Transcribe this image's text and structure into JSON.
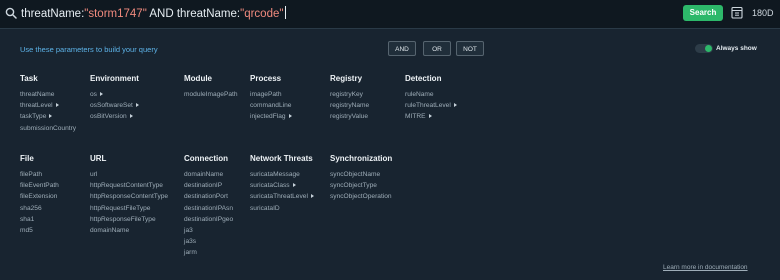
{
  "search": {
    "query": [
      {
        "type": "key",
        "text": "threatName:"
      },
      {
        "type": "val",
        "text": "\"storm1747\""
      },
      {
        "type": "op",
        "text": " AND "
      },
      {
        "type": "key",
        "text": "threatName:"
      },
      {
        "type": "val",
        "text": "\"qrcode\""
      }
    ],
    "search_label": "Search",
    "counter": "180D"
  },
  "panel": {
    "hint": "Use these parameters to build your query",
    "operators": [
      "AND",
      "OR",
      "NOT"
    ],
    "always_show_label": "Always show",
    "always_show_on": true,
    "learn_more": "Learn more in documentation"
  },
  "groups": [
    {
      "title": "Task",
      "items": [
        {
          "label": "threatName",
          "arrow": false
        },
        {
          "label": "threatLevel",
          "arrow": true
        },
        {
          "label": "taskType",
          "arrow": true
        },
        {
          "label": "submissionCountry",
          "arrow": false
        }
      ]
    },
    {
      "title": "Environment",
      "items": [
        {
          "label": "os",
          "arrow": true
        },
        {
          "label": "osSoftwareSet",
          "arrow": true
        },
        {
          "label": "osBitVersion",
          "arrow": true
        }
      ]
    },
    {
      "title": "Module",
      "items": [
        {
          "label": "moduleImagePath",
          "arrow": false
        }
      ]
    },
    {
      "title": "Process",
      "items": [
        {
          "label": "imagePath",
          "arrow": false
        },
        {
          "label": "commandLine",
          "arrow": false
        },
        {
          "label": "injectedFlag",
          "arrow": true
        }
      ]
    },
    {
      "title": "Registry",
      "items": [
        {
          "label": "registryKey",
          "arrow": false
        },
        {
          "label": "registryName",
          "arrow": false
        },
        {
          "label": "registryValue",
          "arrow": false
        }
      ]
    },
    {
      "title": "Detection",
      "items": [
        {
          "label": "ruleName",
          "arrow": false
        },
        {
          "label": "ruleThreatLevel",
          "arrow": true
        },
        {
          "label": "MITRE",
          "arrow": true
        }
      ]
    },
    {
      "title": "File",
      "items": [
        {
          "label": "filePath",
          "arrow": false
        },
        {
          "label": "fileEventPath",
          "arrow": false
        },
        {
          "label": "fileExtension",
          "arrow": false
        },
        {
          "label": "sha256",
          "arrow": false
        },
        {
          "label": "sha1",
          "arrow": false
        },
        {
          "label": "md5",
          "arrow": false
        }
      ]
    },
    {
      "title": "URL",
      "items": [
        {
          "label": "url",
          "arrow": false
        },
        {
          "label": "httpRequestContentType",
          "arrow": false
        },
        {
          "label": "httpResponseContentType",
          "arrow": false
        },
        {
          "label": "httpRequestFileType",
          "arrow": false
        },
        {
          "label": "httpResponseFileType",
          "arrow": false
        },
        {
          "label": "domainName",
          "arrow": false
        }
      ]
    },
    {
      "title": "Connection",
      "items": [
        {
          "label": "domainName",
          "arrow": false
        },
        {
          "label": "destinationIP",
          "arrow": false
        },
        {
          "label": "destinationPort",
          "arrow": false
        },
        {
          "label": "destinationIPAsn",
          "arrow": false
        },
        {
          "label": "destinationIPgeo",
          "arrow": false
        },
        {
          "label": "ja3",
          "arrow": false
        },
        {
          "label": "ja3s",
          "arrow": false
        },
        {
          "label": "jarm",
          "arrow": false
        }
      ]
    },
    {
      "title": "Network Threats",
      "items": [
        {
          "label": "suricataMessage",
          "arrow": false
        },
        {
          "label": "suricataClass",
          "arrow": true
        },
        {
          "label": "suricataThreatLevel",
          "arrow": true
        },
        {
          "label": "suricataID",
          "arrow": false
        }
      ]
    },
    {
      "title": "Synchronization",
      "items": [
        {
          "label": "syncObjectName",
          "arrow": false
        },
        {
          "label": "syncObjectType",
          "arrow": false
        },
        {
          "label": "syncObjectOperation",
          "arrow": false
        }
      ]
    }
  ]
}
